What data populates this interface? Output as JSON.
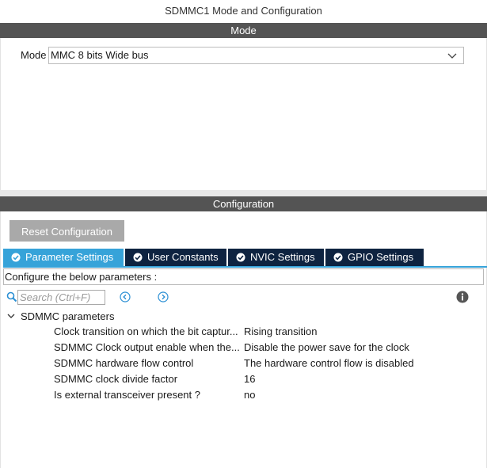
{
  "window": {
    "title": "SDMMC1 Mode and Configuration"
  },
  "mode_section": {
    "header": "Mode",
    "label": "Mode",
    "selected": "MMC 8 bits Wide bus"
  },
  "config_section": {
    "header": "Configuration",
    "reset_button": "Reset Configuration",
    "tabs": [
      {
        "label": "Parameter Settings",
        "active": true
      },
      {
        "label": "User Constants",
        "active": false
      },
      {
        "label": "NVIC Settings",
        "active": false
      },
      {
        "label": "GPIO Settings",
        "active": false
      }
    ],
    "description": "Configure the below parameters :",
    "search_placeholder": "Search (Ctrl+F)",
    "group": {
      "label": "SDMMC parameters",
      "rows": [
        {
          "name": "Clock transition on which the bit captur...",
          "value": "Rising transition"
        },
        {
          "name": "SDMMC Clock output enable when the...",
          "value": "Disable the power save for the clock"
        },
        {
          "name": "SDMMC hardware flow control",
          "value": "The hardware control flow is disabled"
        },
        {
          "name": "SDMMC clock divide factor",
          "value": "16"
        },
        {
          "name": "Is external transceiver present ?",
          "value": "no"
        }
      ]
    }
  },
  "colors": {
    "section_header_bg": "#545454",
    "active_tab": "#36a3d9",
    "inactive_tab": "#0e2340",
    "button_bg": "#a9a9a9",
    "icon_blue": "#2a8fd4"
  },
  "icons": {
    "dropdown": "chevron-down-icon",
    "tab_check": "check-circle-icon",
    "search": "search-icon",
    "prev": "arrow-left-circle-icon",
    "next": "arrow-right-circle-icon",
    "info": "info-icon",
    "tree_toggle": "chevron-down-icon"
  }
}
